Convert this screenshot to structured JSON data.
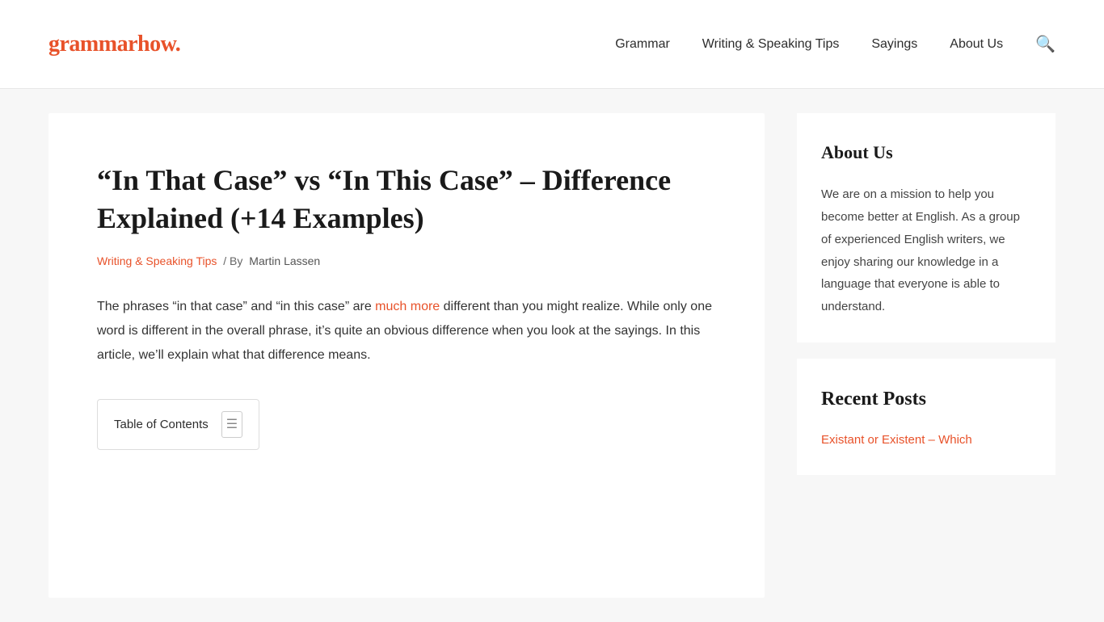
{
  "header": {
    "logo_text": "grammarhow",
    "logo_dot": ".",
    "nav": {
      "items": [
        {
          "label": "Grammar",
          "href": "#"
        },
        {
          "label": "Writing & Speaking Tips",
          "href": "#"
        },
        {
          "label": "Sayings",
          "href": "#"
        },
        {
          "label": "About Us",
          "href": "#"
        }
      ]
    },
    "search_icon": "🔍"
  },
  "article": {
    "title": "“In That Case” vs “In This Case” – Difference Explained (+14 Examples)",
    "meta": {
      "category": "Writing & Speaking Tips",
      "separator": "/ By",
      "author": "Martin Lassen"
    },
    "body_part1": "The phrases “in that case” and “in this case” are ",
    "body_link": "much more",
    "body_part2": " different than you might realize. While only one word is different in the overall phrase, it’s quite an obvious difference when you look at the sayings. In this article, we’ll explain what that difference means.",
    "toc_label": "Table of Contents",
    "toc_icon": "☰"
  },
  "sidebar": {
    "about": {
      "title": "About Us",
      "text": "We are on a mission to help you become better at English. As a group of experienced English writers, we enjoy sharing our knowledge in a language that everyone is able to understand."
    },
    "recent_posts": {
      "title": "Recent Posts",
      "link_text": "Existant or Existent – Which"
    }
  }
}
